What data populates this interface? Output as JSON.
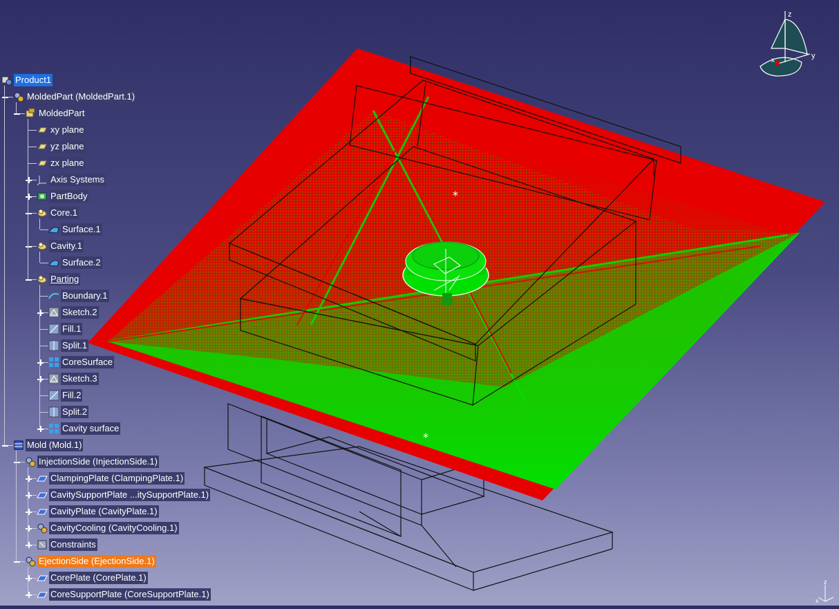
{
  "tree": {
    "nodes": [
      {
        "label": "Product1",
        "level": 0,
        "icon": "product-icon",
        "expander": "",
        "state": "selected"
      },
      {
        "label": "MoldedPart (MoldedPart.1)",
        "level": 1,
        "icon": "component-icon",
        "expander": "minus",
        "state": ""
      },
      {
        "label": "MoldedPart",
        "level": 2,
        "icon": "part-icon",
        "expander": "minus",
        "state": ""
      },
      {
        "label": "xy plane",
        "level": 3,
        "icon": "plane-icon",
        "expander": "",
        "state": ""
      },
      {
        "label": "yz plane",
        "level": 3,
        "icon": "plane-icon",
        "expander": "",
        "state": ""
      },
      {
        "label": "zx plane",
        "level": 3,
        "icon": "plane-icon",
        "expander": "",
        "state": ""
      },
      {
        "label": "Axis Systems",
        "level": 3,
        "icon": "axis-system-icon",
        "expander": "plus",
        "state": ""
      },
      {
        "label": "PartBody",
        "level": 3,
        "icon": "partbody-icon",
        "expander": "plus",
        "state": ""
      },
      {
        "label": "Core.1",
        "level": 3,
        "icon": "geometrical-set-icon",
        "expander": "minus",
        "state": ""
      },
      {
        "label": "Surface.1",
        "level": 4,
        "icon": "surface-icon",
        "expander": "",
        "state": ""
      },
      {
        "label": "Cavity.1",
        "level": 3,
        "icon": "geometrical-set-icon",
        "expander": "minus",
        "state": ""
      },
      {
        "label": "Surface.2",
        "level": 4,
        "icon": "surface-icon",
        "expander": "",
        "state": ""
      },
      {
        "label": "Parting",
        "level": 3,
        "icon": "geometrical-set-icon",
        "expander": "minus",
        "state": "underline"
      },
      {
        "label": "Boundary.1",
        "level": 4,
        "icon": "boundary-icon",
        "expander": "",
        "state": ""
      },
      {
        "label": "Sketch.2",
        "level": 4,
        "icon": "sketch-icon",
        "expander": "plus",
        "state": ""
      },
      {
        "label": "Fill.1",
        "level": 4,
        "icon": "fill-icon",
        "expander": "",
        "state": ""
      },
      {
        "label": "Split.1",
        "level": 4,
        "icon": "split-icon",
        "expander": "",
        "state": ""
      },
      {
        "label": "CoreSurface",
        "level": 4,
        "icon": "join-surface-icon",
        "expander": "plus",
        "state": ""
      },
      {
        "label": "Sketch.3",
        "level": 4,
        "icon": "sketch-icon",
        "expander": "plus",
        "state": ""
      },
      {
        "label": "Fill.2",
        "level": 4,
        "icon": "fill-icon",
        "expander": "",
        "state": ""
      },
      {
        "label": "Split.2",
        "level": 4,
        "icon": "split-icon",
        "expander": "",
        "state": ""
      },
      {
        "label": "Cavity surface",
        "level": 4,
        "icon": "join-surface-icon",
        "expander": "plus",
        "state": ""
      },
      {
        "label": "Mold (Mold.1)",
        "level": 1,
        "icon": "mold-icon",
        "expander": "minus",
        "state": ""
      },
      {
        "label": "InjectionSide (InjectionSide.1)",
        "level": 2,
        "icon": "component-icon",
        "expander": "minus",
        "state": ""
      },
      {
        "label": "ClampingPlate (ClampingPlate.1)",
        "level": 3,
        "icon": "plate-icon",
        "expander": "plus",
        "state": ""
      },
      {
        "label": "CavitySupportPlate ...itySupportPlate.1)",
        "level": 3,
        "icon": "plate-icon",
        "expander": "plus",
        "state": ""
      },
      {
        "label": "CavityPlate (CavityPlate.1)",
        "level": 3,
        "icon": "plate-icon",
        "expander": "plus",
        "state": ""
      },
      {
        "label": "CavityCooling (CavityCooling.1)",
        "level": 3,
        "icon": "component-icon",
        "expander": "plus",
        "state": ""
      },
      {
        "label": "Constraints",
        "level": 3,
        "icon": "constraints-icon",
        "expander": "plus",
        "state": ""
      },
      {
        "label": "EjectionSide (EjectionSide.1)",
        "level": 2,
        "icon": "component-icon",
        "expander": "minus",
        "state": "highlighted"
      },
      {
        "label": "CorePlate (CorePlate.1)",
        "level": 3,
        "icon": "plate-icon",
        "expander": "plus",
        "state": ""
      },
      {
        "label": "CoreSupportPlate (CoreSupportPlate.1)",
        "level": 3,
        "icon": "plate-icon",
        "expander": "plus",
        "state": ""
      }
    ]
  },
  "compass": {
    "axes": [
      "z",
      "y",
      "x"
    ]
  },
  "mini_axis": {
    "axes": [
      "z",
      "x"
    ]
  },
  "colors": {
    "cavity_surface": "#e60000",
    "core_surface": "#00e000",
    "selection": "#1f6fe0",
    "highlight": "#ee7a1a",
    "wireframe": "#111111"
  }
}
